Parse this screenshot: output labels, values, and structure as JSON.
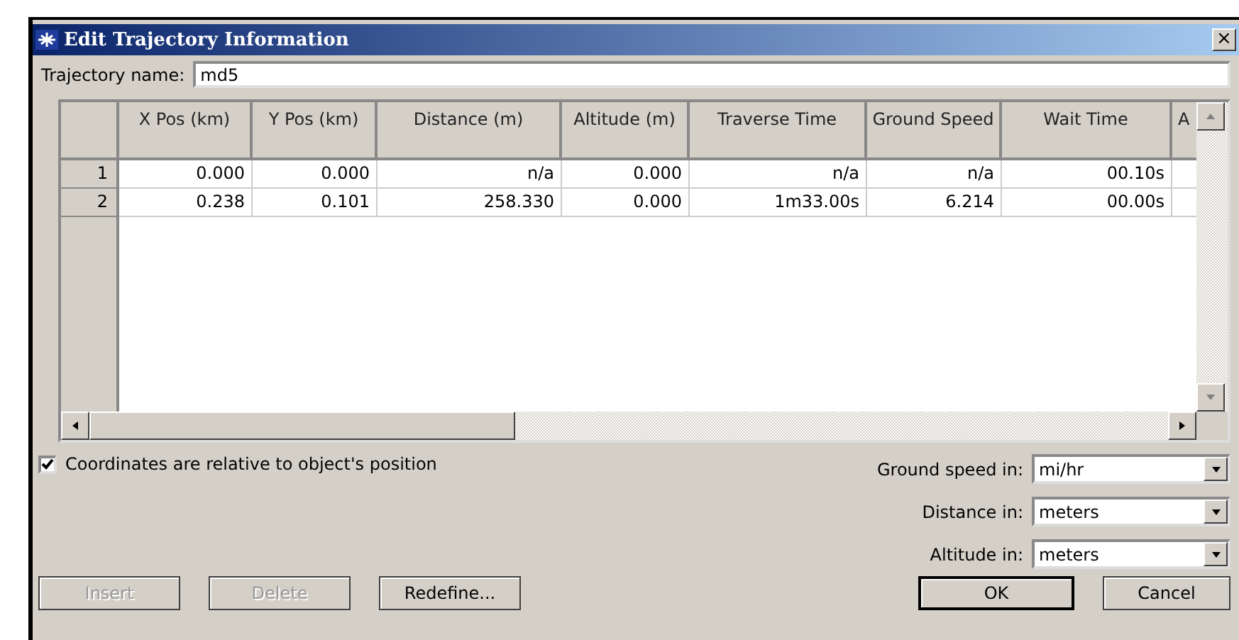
{
  "window": {
    "title": "Edit Trajectory Information",
    "close": "×"
  },
  "trajectory_name": {
    "label": "Trajectory name:",
    "value": "md5"
  },
  "table": {
    "columns": [
      "X Pos (km)",
      "Y Pos (km)",
      "Distance (m)",
      "Altitude (m)",
      "Traverse Time",
      "Ground Speed",
      "Wait Time",
      "A"
    ],
    "rows": [
      {
        "header": "1",
        "cells": [
          "0.000",
          "0.000",
          "n/a",
          "0.000",
          "n/a",
          "n/a",
          "00.10s",
          ""
        ]
      },
      {
        "header": "2",
        "cells": [
          "0.238",
          "0.101",
          "258.330",
          "0.000",
          "1m33.00s",
          "6.214",
          "00.00s",
          ""
        ]
      }
    ]
  },
  "relative_checkbox": {
    "label": "Coordinates are relative to object's position",
    "checked": true
  },
  "units": [
    {
      "label": "Ground speed in:",
      "value": "mi/hr"
    },
    {
      "label": "Distance in:",
      "value": "meters"
    },
    {
      "label": "Altitude in:",
      "value": "meters"
    }
  ],
  "buttons": [
    {
      "label": "Insert",
      "disabled": true,
      "default": false
    },
    {
      "label": "Delete",
      "disabled": true,
      "default": false
    },
    {
      "label": "Redefine...",
      "disabled": false,
      "default": false
    },
    {
      "label": "OK",
      "disabled": false,
      "default": true
    },
    {
      "label": "Cancel",
      "disabled": false,
      "default": false
    }
  ]
}
